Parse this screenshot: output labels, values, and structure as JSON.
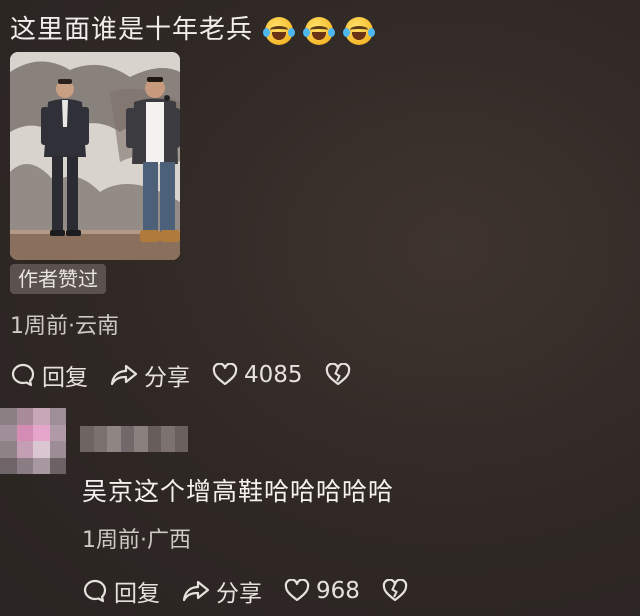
{
  "comment1": {
    "text": "这里面谁是十年老兵",
    "emojis": [
      "laughing-crying-emoji",
      "laughing-crying-emoji",
      "laughing-crying-emoji"
    ],
    "badge": "作者赞过",
    "meta": "1周前·云南",
    "actions": {
      "reply_label": "回复",
      "share_label": "分享",
      "like_count": "4085"
    }
  },
  "comment2": {
    "text": "吴京这个增高鞋哈哈哈哈哈",
    "meta": "1周前·广西",
    "actions": {
      "reply_label": "回复",
      "share_label": "分享",
      "like_count": "968"
    }
  },
  "colors": {
    "background": "#2f2825",
    "badge_bg": "#5a524e",
    "text_primary": "#f1eeec",
    "text_secondary": "#cfc9c5"
  },
  "icons": [
    "comment-bubble-icon",
    "share-arrow-icon",
    "heart-icon",
    "broken-heart-icon"
  ]
}
